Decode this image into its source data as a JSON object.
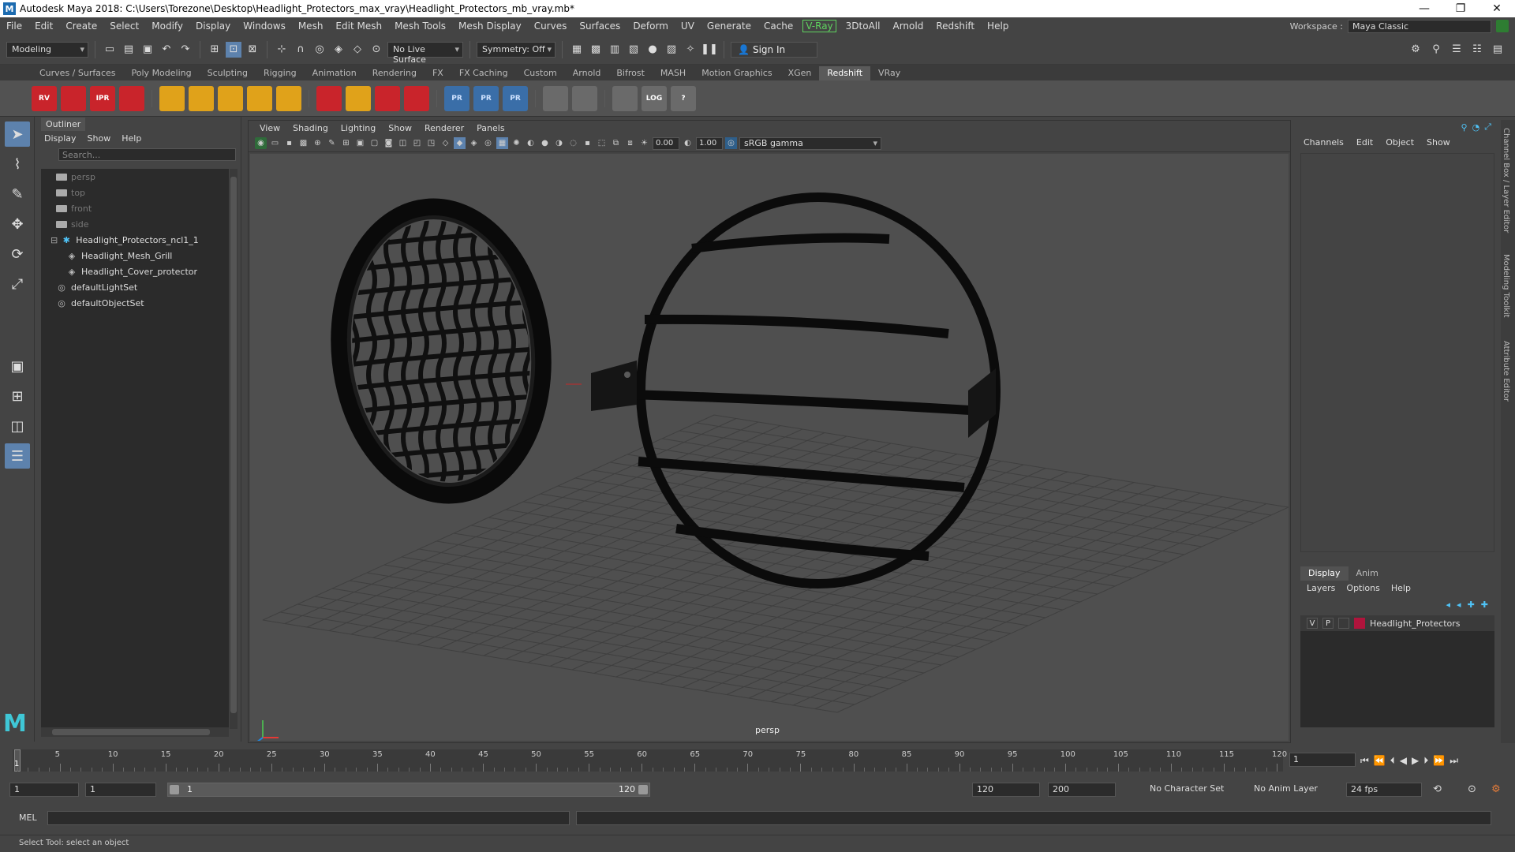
{
  "window": {
    "title": "Autodesk Maya 2018: C:\\Users\\Torezone\\Desktop\\Headlight_Protectors_max_vray\\Headlight_Protectors_mb_vray.mb*",
    "logo": "M"
  },
  "menubar": {
    "items": [
      "File",
      "Edit",
      "Create",
      "Select",
      "Modify",
      "Display",
      "Windows",
      "Mesh",
      "Edit Mesh",
      "Mesh Tools",
      "Mesh Display",
      "Curves",
      "Surfaces",
      "Deform",
      "UV",
      "Generate",
      "Cache",
      "V-Ray",
      "3DtoAll",
      "Arnold",
      "Redshift",
      "Help"
    ],
    "workspace_label": "Workspace :",
    "workspace_value": "Maya Classic"
  },
  "statusline": {
    "mode": "Modeling",
    "live_surface": "No Live Surface",
    "symmetry": "Symmetry: Off",
    "sign_in": "Sign In"
  },
  "shelf": {
    "tabs": [
      "Curves / Surfaces",
      "Poly Modeling",
      "Sculpting",
      "Rigging",
      "Animation",
      "Rendering",
      "FX",
      "FX Caching",
      "Custom",
      "Arnold",
      "Bifrost",
      "MASH",
      "Motion Graphics",
      "XGen",
      "Redshift",
      "VRay"
    ],
    "active_tab": "Redshift",
    "icons": [
      {
        "label": "RV",
        "style": "red"
      },
      {
        "label": "",
        "style": "red"
      },
      {
        "label": "IPR",
        "style": "red"
      },
      {
        "label": "",
        "style": "red"
      },
      {
        "label": "",
        "style": "gold"
      },
      {
        "label": "",
        "style": "gold"
      },
      {
        "label": "",
        "style": "gold"
      },
      {
        "label": "",
        "style": "gold"
      },
      {
        "label": "",
        "style": "gold"
      },
      {
        "label": "",
        "style": "red"
      },
      {
        "label": "",
        "style": "gold"
      },
      {
        "label": "",
        "style": "red"
      },
      {
        "label": "",
        "style": "red"
      },
      {
        "label": "PR",
        "style": "blue"
      },
      {
        "label": "PR",
        "style": "blue"
      },
      {
        "label": "PR",
        "style": "blue"
      },
      {
        "label": "",
        "style": "gray"
      },
      {
        "label": "",
        "style": "gray"
      },
      {
        "label": "",
        "style": "gray"
      },
      {
        "label": "LOG",
        "style": "gray"
      },
      {
        "label": "?",
        "style": "gray"
      }
    ]
  },
  "outliner": {
    "title": "Outliner",
    "menu": [
      "Display",
      "Show",
      "Help"
    ],
    "search_placeholder": "Search...",
    "nodes": [
      {
        "label": "persp",
        "icon": "camera-icon",
        "indent": 1,
        "dim": true
      },
      {
        "label": "top",
        "icon": "camera-icon",
        "indent": 1,
        "dim": true
      },
      {
        "label": "front",
        "icon": "camera-icon",
        "indent": 1,
        "dim": true
      },
      {
        "label": "side",
        "icon": "camera-icon",
        "indent": 1,
        "dim": true
      },
      {
        "label": "Headlight_Protectors_ncl1_1",
        "icon": "group-icon",
        "indent": 0,
        "dim": false
      },
      {
        "label": "Headlight_Mesh_Grill",
        "icon": "mesh-icon",
        "indent": 2,
        "dim": false
      },
      {
        "label": "Headlight_Cover_protector",
        "icon": "mesh-icon",
        "indent": 2,
        "dim": false
      },
      {
        "label": "defaultLightSet",
        "icon": "set-icon",
        "indent": 1,
        "dim": false
      },
      {
        "label": "defaultObjectSet",
        "icon": "set-icon",
        "indent": 1,
        "dim": false
      }
    ]
  },
  "viewport": {
    "menu": [
      "View",
      "Shading",
      "Lighting",
      "Show",
      "Renderer",
      "Panels"
    ],
    "exposure": "0.00",
    "gamma": "1.00",
    "color_space": "sRGB gamma",
    "camera_label": "persp"
  },
  "channelbox": {
    "menu": [
      "Channels",
      "Edit",
      "Object",
      "Show"
    ],
    "layer_tabs": [
      "Display",
      "Anim"
    ],
    "active_layer_tab": "Display",
    "layer_menu": [
      "Layers",
      "Options",
      "Help"
    ],
    "layers": [
      {
        "v": "V",
        "p": "P",
        "name": "Headlight_Protectors",
        "color": "#b0143c"
      }
    ]
  },
  "sidetabs": [
    "Channel Box / Layer Editor",
    "Modeling Toolkit",
    "Attribute Editor"
  ],
  "timeslider": {
    "ticks": [
      5,
      10,
      15,
      20,
      25,
      30,
      35,
      40,
      45,
      50,
      55,
      60,
      65,
      70,
      75,
      80,
      85,
      90,
      95,
      100,
      105,
      110,
      115,
      120
    ],
    "start": 1,
    "end": 120,
    "current": "1",
    "cursor_label": "1"
  },
  "rangeslider": {
    "start_time": "1",
    "playback_start": "1",
    "range_start_label": "1",
    "range_end_label": "120",
    "playback_end": "120",
    "end_time": "200",
    "character_set": "No Character Set",
    "anim_layer": "No Anim Layer",
    "fps": "24 fps"
  },
  "cmdline": {
    "label": "MEL"
  },
  "helpline": {
    "text": "Select Tool: select an object"
  }
}
